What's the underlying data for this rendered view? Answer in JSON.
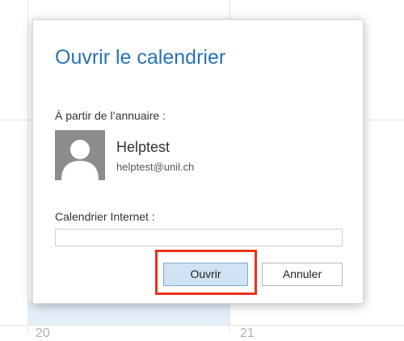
{
  "background": {
    "day_numbers": [
      "20",
      "21"
    ]
  },
  "dialog": {
    "title": "Ouvrir le calendrier",
    "directory_label": "À partir de l’annuaire :",
    "contact": {
      "name": "Helptest",
      "email": "helptest@unil.ch",
      "avatar_icon": "default-user-silhouette-icon"
    },
    "internet_label": "Calendrier Internet :",
    "internet_value": "",
    "internet_placeholder": "",
    "buttons": {
      "open_label": "Ouvrir",
      "cancel_label": "Annuler"
    }
  },
  "colors": {
    "title": "#2a72b5",
    "primary_button_bg": "#cfe3f4",
    "highlight": "#e8331c"
  }
}
